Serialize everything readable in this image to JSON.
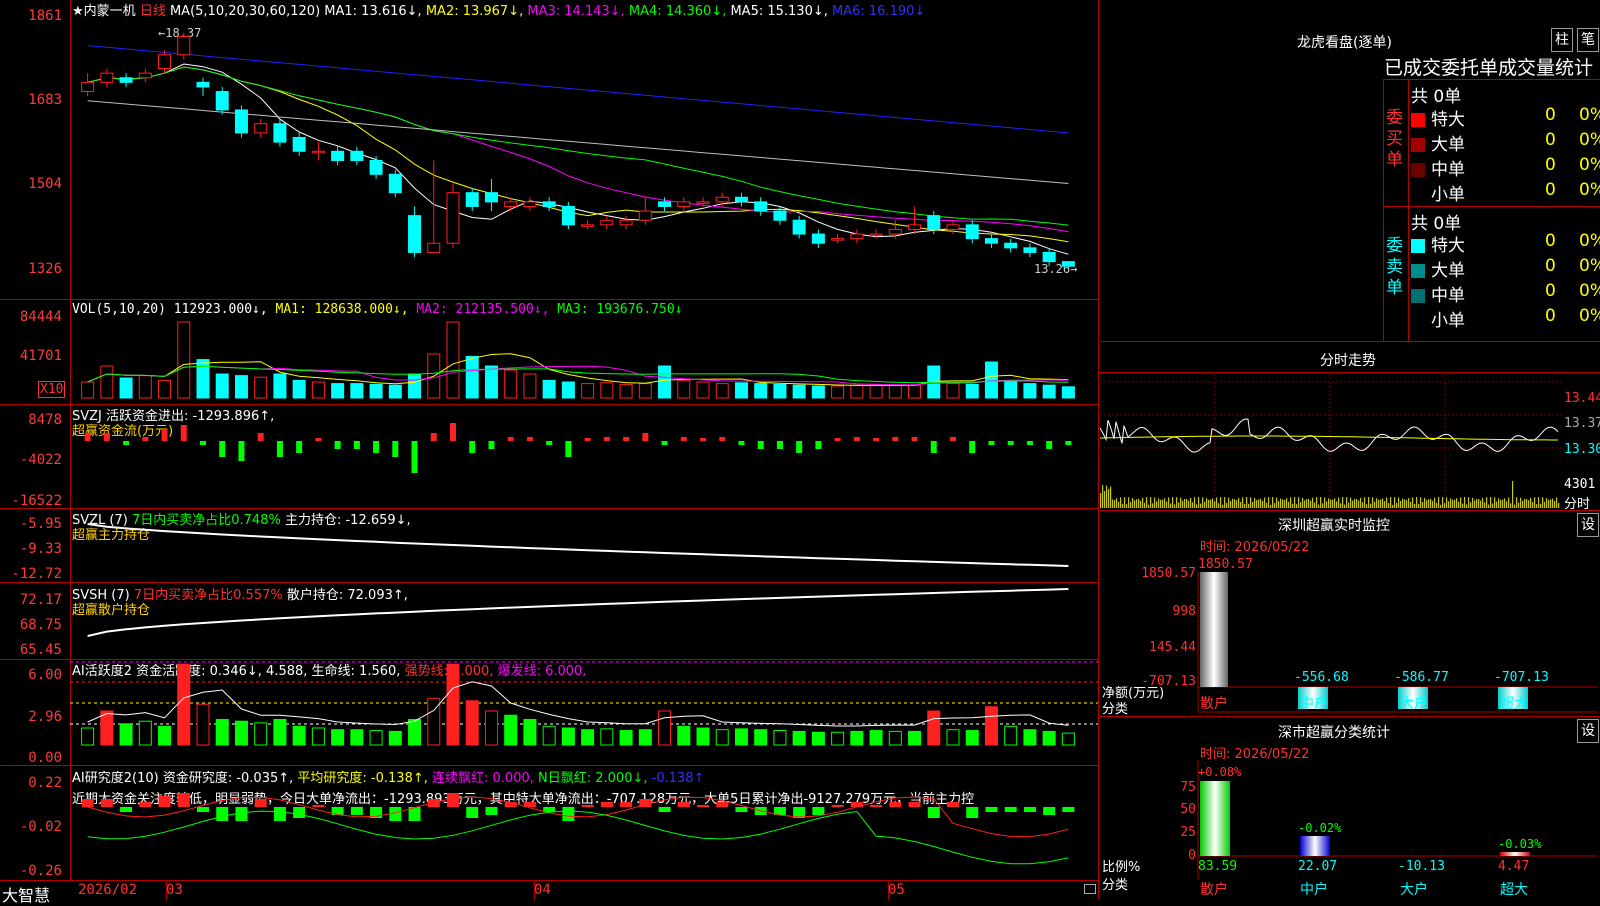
{
  "stock": {
    "star": "★",
    "name": "内蒙一机",
    "period": "日线"
  },
  "ma_header": {
    "label": "MA(5,10,20,30,60,120)",
    "ma1": "MA1: 13.616↓,",
    "ma2": "MA2: 13.967↓,",
    "ma3": "MA3: 14.143↓,",
    "ma4": "MA4: 14.360↓,",
    "ma5": "MA5: 15.130↓,",
    "ma6": "MA6: 16.190↓"
  },
  "price_axis": [
    "1861",
    "1683",
    "1504",
    "1326"
  ],
  "price_marks": {
    "high": "←18.37",
    "low": "13.26→"
  },
  "vol_header": {
    "label": "VOL(5,10,20)",
    "vol": "112923.000↓,",
    "ma1": "MA1: 128638.000↓,",
    "ma2": "MA2: 212135.500↓,",
    "ma3": "MA3: 193676.750↓"
  },
  "vol_axis": [
    "84444",
    "41701"
  ],
  "vol_unit": "X10",
  "svzj": {
    "line1": "SVZJ  活跃资金进出: -1293.896↑,",
    "line2": "超赢资金流(万元)",
    "axis": [
      "8478",
      "-4022",
      "-16522"
    ]
  },
  "svzl": {
    "label": "SVZL (7)",
    "ratio": "7日内买卖净占比0.748%",
    "hold": "主力持仓: -12.659↓,",
    "line2": "超赢主力持仓",
    "axis": [
      "-5.95",
      "-9.33",
      "-12.72"
    ]
  },
  "svsh": {
    "label": "SVSH (7)",
    "ratio": "7日内买卖净占比0.557%",
    "hold": "散户持仓: 72.093↑,",
    "line2": "超赢散户持仓",
    "axis": [
      "72.17",
      "68.75",
      "65.45"
    ]
  },
  "ai1": {
    "label": "AI活跃度2",
    "v1": "资金活跃度: 0.346↓,",
    "v2": "4.588,",
    "v3": "生命线: 1.560,",
    "v4": "强势线: 3.000,",
    "v5": "爆发线: 6.000,",
    "axis": [
      "6.00",
      "2.96",
      "0.00"
    ]
  },
  "ai2": {
    "label": "AI研究度2(10)",
    "v1": "资金研究度: -0.035↑,",
    "v2": "平均研究度: -0.138↑,",
    "v3": "连续飘红: 0.000,",
    "v4": "N日飘红: 2.000↓,",
    "v5": "-0.138↑",
    "note": "近期大资金关注度较低，明显弱势，今日大单净流出：-1293.893万元，其中特大单净流出：-707.128万元，大单5日累计净出-9127.279万元，当前主力控",
    "axis": [
      "0.22",
      "-0.02",
      "-0.26"
    ]
  },
  "xaxis": {
    "brand": "大智慧",
    "labels": [
      "2026/02",
      "03",
      "04",
      "05"
    ]
  },
  "lhb": {
    "title": "龙虎看盘(逐单)",
    "btn1": "柱",
    "btn2": "笔",
    "subtitle": "已成交委托单成交量统计",
    "buy": {
      "side": "委买单",
      "total": "共 0单",
      "rows": [
        {
          "name": "特大",
          "color": "#ff0000",
          "v": "0",
          "p": "0%"
        },
        {
          "name": "大单",
          "color": "#a00000",
          "v": "0",
          "p": "0%"
        },
        {
          "name": "中单",
          "color": "#6a0000",
          "v": "0",
          "p": "0%"
        },
        {
          "name": "小单",
          "color": "#000000",
          "v": "0",
          "p": "0%"
        }
      ]
    },
    "sell": {
      "side": "委卖单",
      "total": "共 0单",
      "rows": [
        {
          "name": "特大",
          "color": "#00ffff",
          "v": "0",
          "p": "0%"
        },
        {
          "name": "大单",
          "color": "#008c8c",
          "v": "0",
          "p": "0%"
        },
        {
          "name": "中单",
          "color": "#007070",
          "v": "0",
          "p": "0%"
        },
        {
          "name": "小单",
          "color": "#000000",
          "v": "0",
          "p": "0%"
        }
      ]
    }
  },
  "fenshi": {
    "title": "分时走势",
    "axis": [
      "13.44",
      "13.37",
      "13.30",
      "4301"
    ],
    "unit": "分时"
  },
  "sz_monitor": {
    "title": "深圳超赢实时监控",
    "btn": "设",
    "time": "时间: 2026/05/22",
    "axis": [
      "1850.57",
      "998",
      "145.44",
      "-707.13"
    ],
    "top": "1850.57",
    "values": [
      "-556.68",
      "-586.77",
      "-707.13"
    ],
    "ylabel": "净额(万元)",
    "xlabel": "分类",
    "cats": [
      "散户",
      "中户",
      "大户",
      "超大"
    ]
  },
  "sz_class": {
    "title": "深市超赢分类统计",
    "btn": "设",
    "time": "时间: 2026/05/22",
    "axis": [
      "75",
      "50",
      "25",
      "0"
    ],
    "labels": [
      "+0.08%",
      "-0.02%",
      "-0.03%"
    ],
    "ylabel": "比例%",
    "xlabel": "分类",
    "values": [
      "83.59",
      "22.07",
      "-10.13",
      "4.47"
    ],
    "cats": [
      "散户",
      "中户",
      "大户",
      "超大"
    ]
  },
  "colors": {
    "up": "#ff2020",
    "down": "#00ffff",
    "frame": "#b00000"
  },
  "chart_data": {
    "type": "candlestick",
    "title": "内蒙一机 日线",
    "open": [
      17.1,
      17.3,
      17.4,
      17.4,
      17.6,
      17.9,
      17.3,
      17.1,
      16.7,
      16.2,
      16.4,
      16.1,
      15.8,
      15.8,
      15.8,
      15.6,
      15.3,
      14.4,
      13.6,
      13.8,
      14.9,
      14.9,
      14.6,
      14.6,
      14.7,
      14.6,
      14.2,
      14.2,
      14.2,
      14.3,
      14.7,
      14.6,
      14.7,
      14.7,
      14.8,
      14.7,
      14.5,
      14.3,
      14.0,
      13.9,
      13.9,
      14.0,
      14.0,
      14.1,
      14.4,
      14.1,
      14.2,
      13.9,
      13.8,
      13.7,
      13.6,
      13.4
    ],
    "close": [
      17.3,
      17.5,
      17.3,
      17.5,
      17.9,
      18.3,
      17.2,
      16.7,
      16.2,
      16.4,
      16.0,
      15.8,
      15.8,
      15.6,
      15.6,
      15.3,
      14.9,
      13.6,
      13.8,
      14.9,
      14.6,
      14.7,
      14.7,
      14.7,
      14.6,
      14.2,
      14.2,
      14.3,
      14.3,
      14.5,
      14.6,
      14.7,
      14.7,
      14.8,
      14.7,
      14.5,
      14.3,
      14.0,
      13.8,
      13.9,
      14.0,
      14.0,
      14.1,
      14.2,
      14.1,
      14.2,
      13.9,
      13.8,
      13.7,
      13.6,
      13.4,
      13.3
    ],
    "high": [
      17.5,
      17.6,
      17.5,
      17.6,
      18.0,
      18.37,
      17.4,
      17.2,
      16.8,
      16.5,
      16.5,
      16.2,
      16.0,
      15.9,
      15.9,
      15.7,
      15.4,
      14.6,
      15.6,
      15.1,
      15.0,
      15.2,
      14.8,
      14.8,
      14.8,
      14.7,
      14.3,
      14.4,
      14.4,
      14.8,
      14.8,
      14.8,
      14.8,
      14.9,
      14.9,
      14.8,
      14.6,
      14.4,
      14.1,
      14.0,
      14.1,
      14.1,
      14.3,
      14.6,
      14.5,
      14.3,
      14.3,
      14.0,
      13.9,
      13.8,
      13.7,
      13.4
    ],
    "low": [
      17.0,
      17.2,
      17.2,
      17.3,
      17.5,
      17.8,
      17.0,
      16.6,
      16.1,
      16.1,
      15.9,
      15.7,
      15.6,
      15.5,
      15.5,
      15.2,
      14.8,
      13.5,
      13.6,
      13.7,
      14.5,
      14.5,
      14.5,
      14.5,
      14.5,
      14.1,
      14.1,
      14.1,
      14.1,
      14.2,
      14.5,
      14.5,
      14.6,
      14.6,
      14.6,
      14.4,
      14.2,
      13.9,
      13.7,
      13.8,
      13.8,
      13.9,
      13.9,
      14.0,
      14.0,
      14.0,
      13.8,
      13.7,
      13.6,
      13.5,
      13.3,
      13.26
    ],
    "volume": [
      20000,
      40000,
      25000,
      28000,
      22000,
      95000,
      48000,
      30000,
      28000,
      26000,
      30000,
      22000,
      20000,
      18000,
      18000,
      17000,
      16000,
      30000,
      55000,
      95000,
      52000,
      40000,
      35000,
      30000,
      22000,
      20000,
      18000,
      19000,
      17000,
      18000,
      40000,
      22000,
      20000,
      18000,
      19000,
      18000,
      17000,
      16000,
      15000,
      15000,
      16000,
      17000,
      16000,
      16000,
      40000,
      18000,
      17000,
      45000,
      22000,
      18000,
      16000,
      14000
    ],
    "ylim": [
      13.0,
      18.7
    ],
    "yticks": [
      "1861",
      "1683",
      "1504",
      "1326"
    ],
    "xlabels": [
      "2026/02",
      "03",
      "04",
      "05"
    ]
  }
}
